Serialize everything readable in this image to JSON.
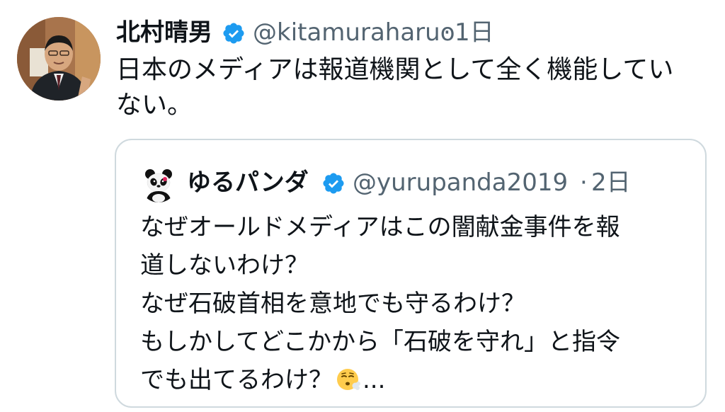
{
  "tweet": {
    "author": {
      "display_name": "北村晴男",
      "handle": "@kitamuraharuo",
      "verified_icon": "verified-badge-icon"
    },
    "separator": "·",
    "time": "1日",
    "more_icon": "more-horizontal-icon",
    "text_lines": [
      "日本のメディアは報道機関として全く機能してい",
      "ない。"
    ]
  },
  "quote": {
    "author": {
      "display_name": "ゆるパンダ",
      "handle": "@yurupanda2019",
      "verified_icon": "verified-badge-icon"
    },
    "separator": "·",
    "time": "2日",
    "text_lines": [
      "なぜオールドメディアはこの闇献金事件を報",
      "道しないわけ？",
      "なぜ石破首相を意地でも守るわけ？",
      "もしかしてどこかから「石破を守れ」と指令"
    ],
    "last_line_prefix": "でも出てるわけ？",
    "last_line_emoji": "face-exhaling-emoji",
    "last_line_suffix": "..."
  },
  "colors": {
    "text": "#0f1419",
    "secondary": "#536471",
    "verified": "#1d9bf0",
    "border": "#cfd9de"
  }
}
